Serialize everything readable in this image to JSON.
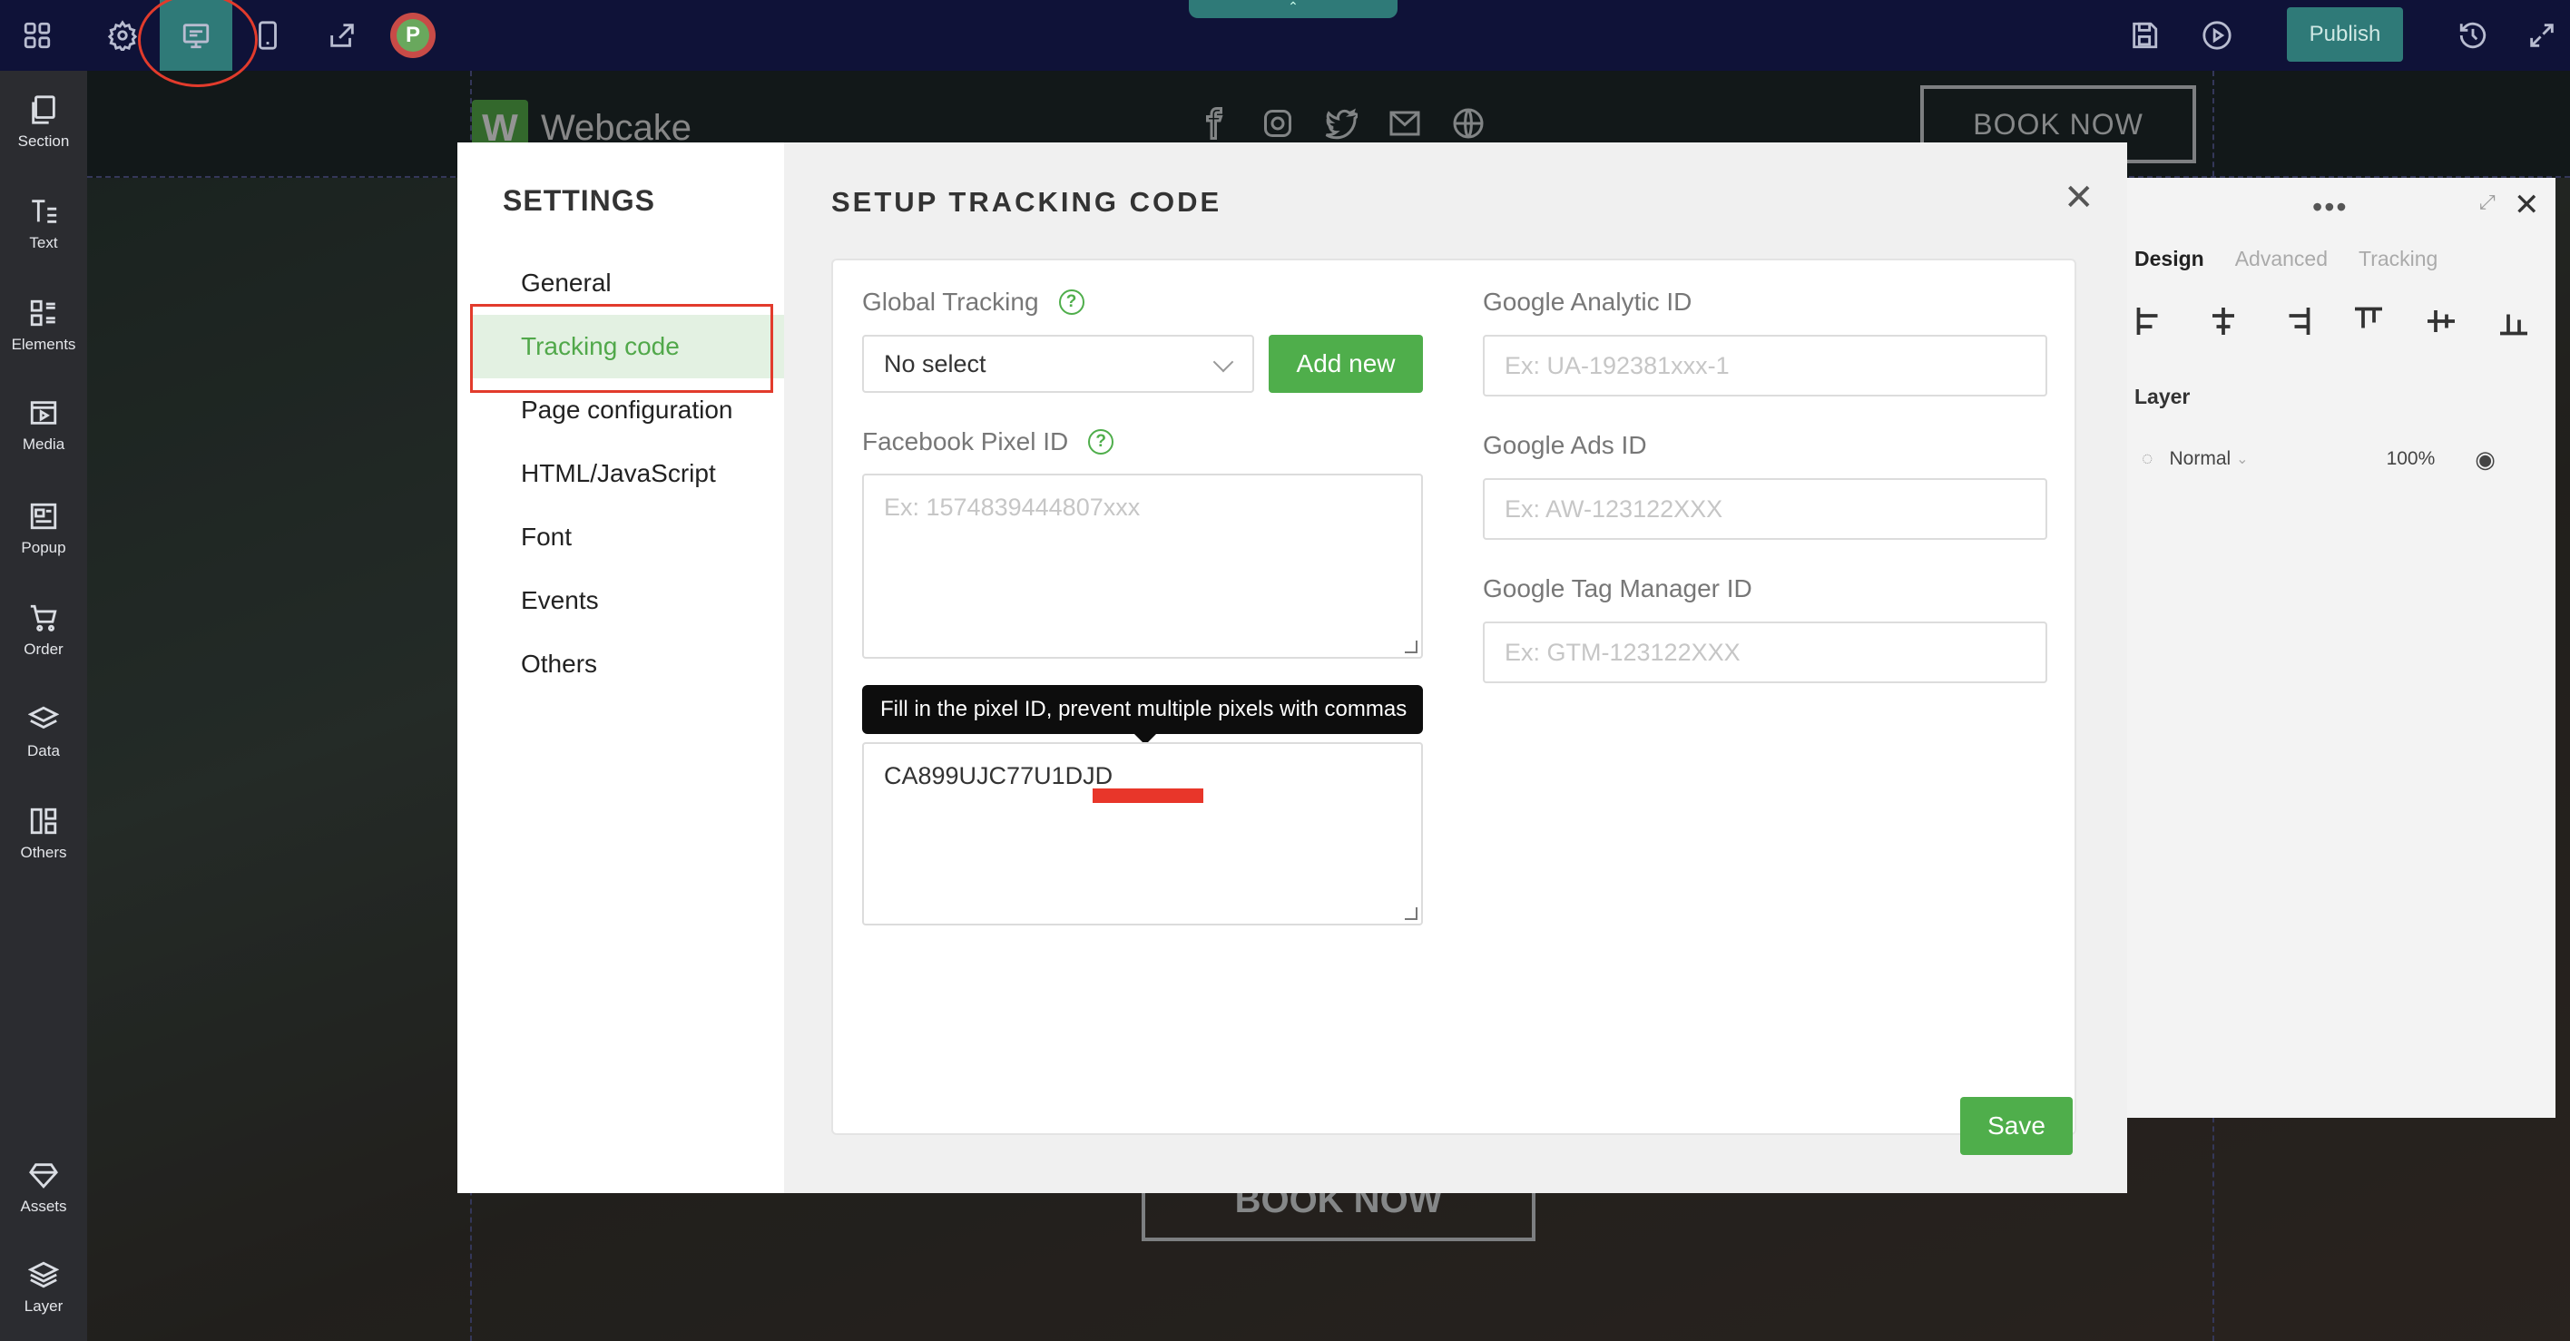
{
  "toolbar": {
    "icons": [
      "grid-icon",
      "settings-icon",
      "desktop-preview-icon",
      "mobile-icon",
      "share-icon"
    ],
    "avatar_letter": "P",
    "publish_label": "Publish",
    "handle_glyph": "⌃"
  },
  "sidebar": {
    "items": [
      {
        "label": "Section",
        "icon": "section-icon"
      },
      {
        "label": "Text",
        "icon": "text-icon"
      },
      {
        "label": "Elements",
        "icon": "elements-icon"
      },
      {
        "label": "Media",
        "icon": "media-icon"
      },
      {
        "label": "Popup",
        "icon": "popup-icon"
      },
      {
        "label": "Order",
        "icon": "cart-icon"
      },
      {
        "label": "Data",
        "icon": "layers-icon"
      },
      {
        "label": "Others",
        "icon": "others-icon"
      },
      {
        "label": "Assets",
        "icon": "diamond-icon"
      },
      {
        "label": "Layer",
        "icon": "layer-icon"
      }
    ]
  },
  "site": {
    "logo_letter": "W",
    "logo_name": "Webcake",
    "book_now_top": "BOOK NOW",
    "book_now_bottom": "BOOK NOW"
  },
  "design_panel": {
    "tabs": [
      "Design",
      "Advanced",
      "Tracking"
    ],
    "active_tab": "Design",
    "layer_title": "Layer",
    "blend_mode": "Normal",
    "opacity": "100%"
  },
  "modal": {
    "settings_title": "SETTINGS",
    "menu": [
      "General",
      "Tracking code",
      "Page configuration",
      "HTML/JavaScript",
      "Font",
      "Events",
      "Others"
    ],
    "active_menu": "Tracking code",
    "title": "SETUP TRACKING CODE",
    "global_tracking": {
      "label": "Global Tracking",
      "value": "No select",
      "add_label": "Add new"
    },
    "facebook_pixel": {
      "label": "Facebook Pixel ID",
      "placeholder": "Ex: 1574839444807xxx",
      "tooltip": "Fill in the pixel ID, prevent multiple pixels with commas",
      "value": "CA899UJC77U1DJD"
    },
    "google_analytic": {
      "label": "Google Analytic ID",
      "placeholder": "Ex: UA-192381xxx-1"
    },
    "google_ads": {
      "label": "Google Ads ID",
      "placeholder": "Ex: AW-123122XXX"
    },
    "google_tag_manager": {
      "label": "Google Tag Manager ID",
      "placeholder": "Ex: GTM-123122XXX"
    },
    "save_label": "Save"
  },
  "colors": {
    "toolbar_bg": "#0f1238",
    "accent_teal": "#2f7a78",
    "green": "#4fae4b",
    "highlight_red": "#e23b2c"
  }
}
